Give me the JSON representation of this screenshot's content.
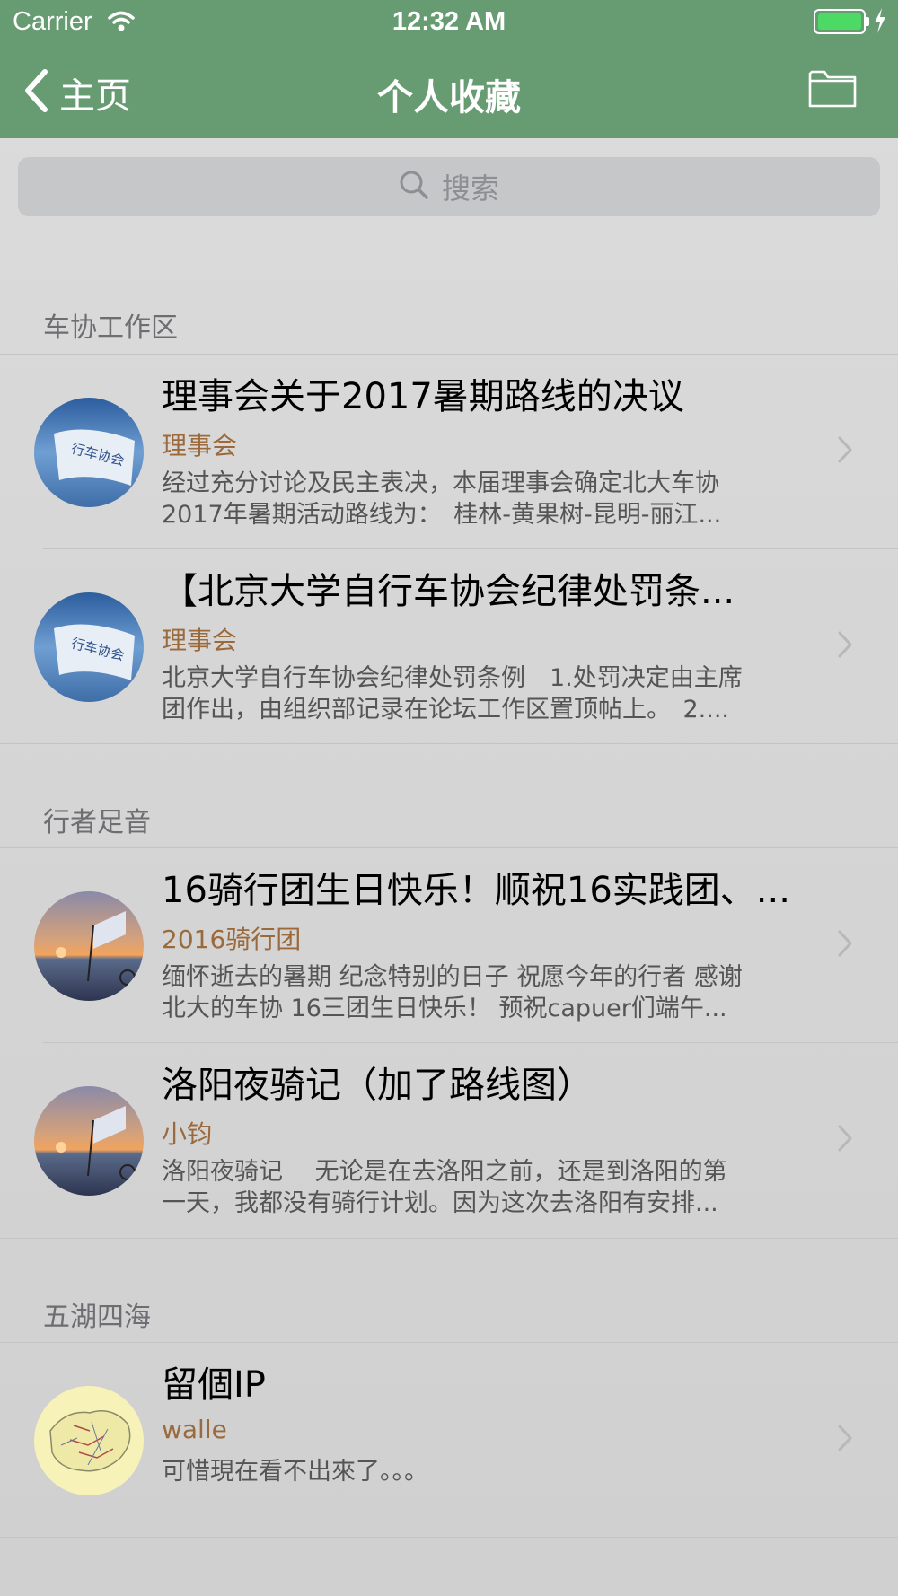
{
  "status_bar": {
    "carrier": "Carrier",
    "time": "12:32 AM",
    "battery_color": "#4cd964"
  },
  "nav": {
    "back_label": "主页",
    "title": "个人收藏",
    "back_icon": "chevron-left-icon",
    "right_icon": "folder-icon",
    "bar_color": "#679c72"
  },
  "search": {
    "placeholder": "搜索",
    "icon": "search-icon"
  },
  "sections": [
    {
      "title": "车协工作区",
      "items": [
        {
          "title": "理事会关于2017暑期路线的决议",
          "author": "理事会",
          "excerpt_line1": "经过充分讨论及民主表决，本届理事会确定北大车协",
          "excerpt_line2": "2017年暑期活动路线为：　桂林-黄果树-昆明-丽江...",
          "avatar": "flag-avatar"
        },
        {
          "title": "【北京大学自行车协会纪律处罚条...",
          "author": "理事会",
          "excerpt_line1": "北京大学自行车协会纪律处罚条例　1.处罚决定由主席",
          "excerpt_line2": "团作出，由组织部记录在论坛工作区置顶帖上。　2....",
          "avatar": "flag-avatar"
        }
      ]
    },
    {
      "title": "行者足音",
      "items": [
        {
          "title": "16骑行团生日快乐！顺祝16实践团、...",
          "author": "2016骑行团",
          "excerpt_line1": "缅怀逝去的暑期 纪念特别的日子 祝愿今年的行者 感谢",
          "excerpt_line2": "北大的车协  16三团生日快乐！ 预祝capuer们端午...",
          "avatar": "sunset-bike-avatar"
        },
        {
          "title": "洛阳夜骑记（加了路线图）",
          "author": "小钧",
          "excerpt_line1": "洛阳夜骑记　 无论是在去洛阳之前，还是到洛阳的第",
          "excerpt_line2": "一天，我都没有骑行计划。因为这次去洛阳有安排...",
          "avatar": "sunset-bike-avatar"
        }
      ]
    },
    {
      "title": "五湖四海",
      "items": [
        {
          "title": "留個IP",
          "author": "walle",
          "excerpt_line1": "可惜現在看不出來了。。。",
          "excerpt_line2": "",
          "avatar": "map-avatar"
        }
      ]
    }
  ]
}
